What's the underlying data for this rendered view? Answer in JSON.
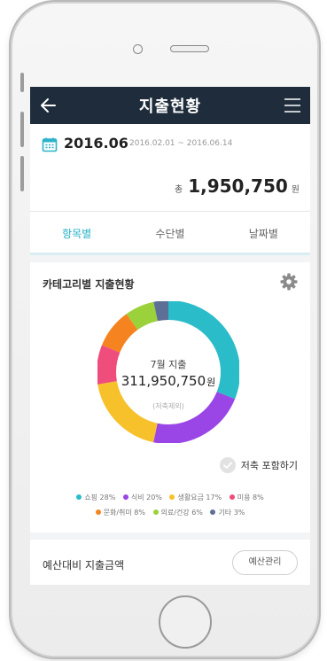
{
  "header": {
    "title": "지출현황"
  },
  "summary": {
    "month": "2016.06",
    "range": "2016.02.01 ~ 2016.06.14",
    "total_prefix": "총",
    "total_amount": "1,950,750",
    "total_suffix": "원"
  },
  "tabs": [
    {
      "label": "항목별",
      "active": true
    },
    {
      "label": "수단별",
      "active": false
    },
    {
      "label": "날짜별",
      "active": false
    }
  ],
  "chart_card": {
    "title": "카테고리별 지출현황",
    "center_sub": "7월 지출",
    "center_amount": "311,950,750",
    "center_unit": "원",
    "center_note": "(저축제외)",
    "toggle_label": "저축 포함하기"
  },
  "chart_data": {
    "type": "pie",
    "title": "카테고리별 지출현황",
    "categories": [
      "쇼핑",
      "식비",
      "생활요금",
      "미용",
      "문화/취미",
      "의료/건강",
      "기타"
    ],
    "values": [
      28,
      20,
      17,
      8,
      8,
      6,
      3
    ],
    "legend_labels": [
      "쇼핑 28%",
      "식비 20%",
      "생활요금 17%",
      "미용 8%",
      "문화/취미 8%",
      "의료/건강 6%",
      "기타 3%"
    ],
    "colors": [
      "#2bbcc9",
      "#9a45e6",
      "#f7c12c",
      "#ef4d7c",
      "#f5831f",
      "#9bd13a",
      "#5d6f96"
    ]
  },
  "budget": {
    "title": "예산대비 지출금액",
    "button_label": "예산관리"
  },
  "icons": {
    "back": "arrow-left-icon",
    "menu": "hamburger-menu-icon",
    "calendar": "calendar-icon",
    "settings": "gear-icon",
    "check": "check-circle-icon"
  },
  "colors": {
    "topbar": "#1e2c3b",
    "accent": "#2ab9cf"
  }
}
